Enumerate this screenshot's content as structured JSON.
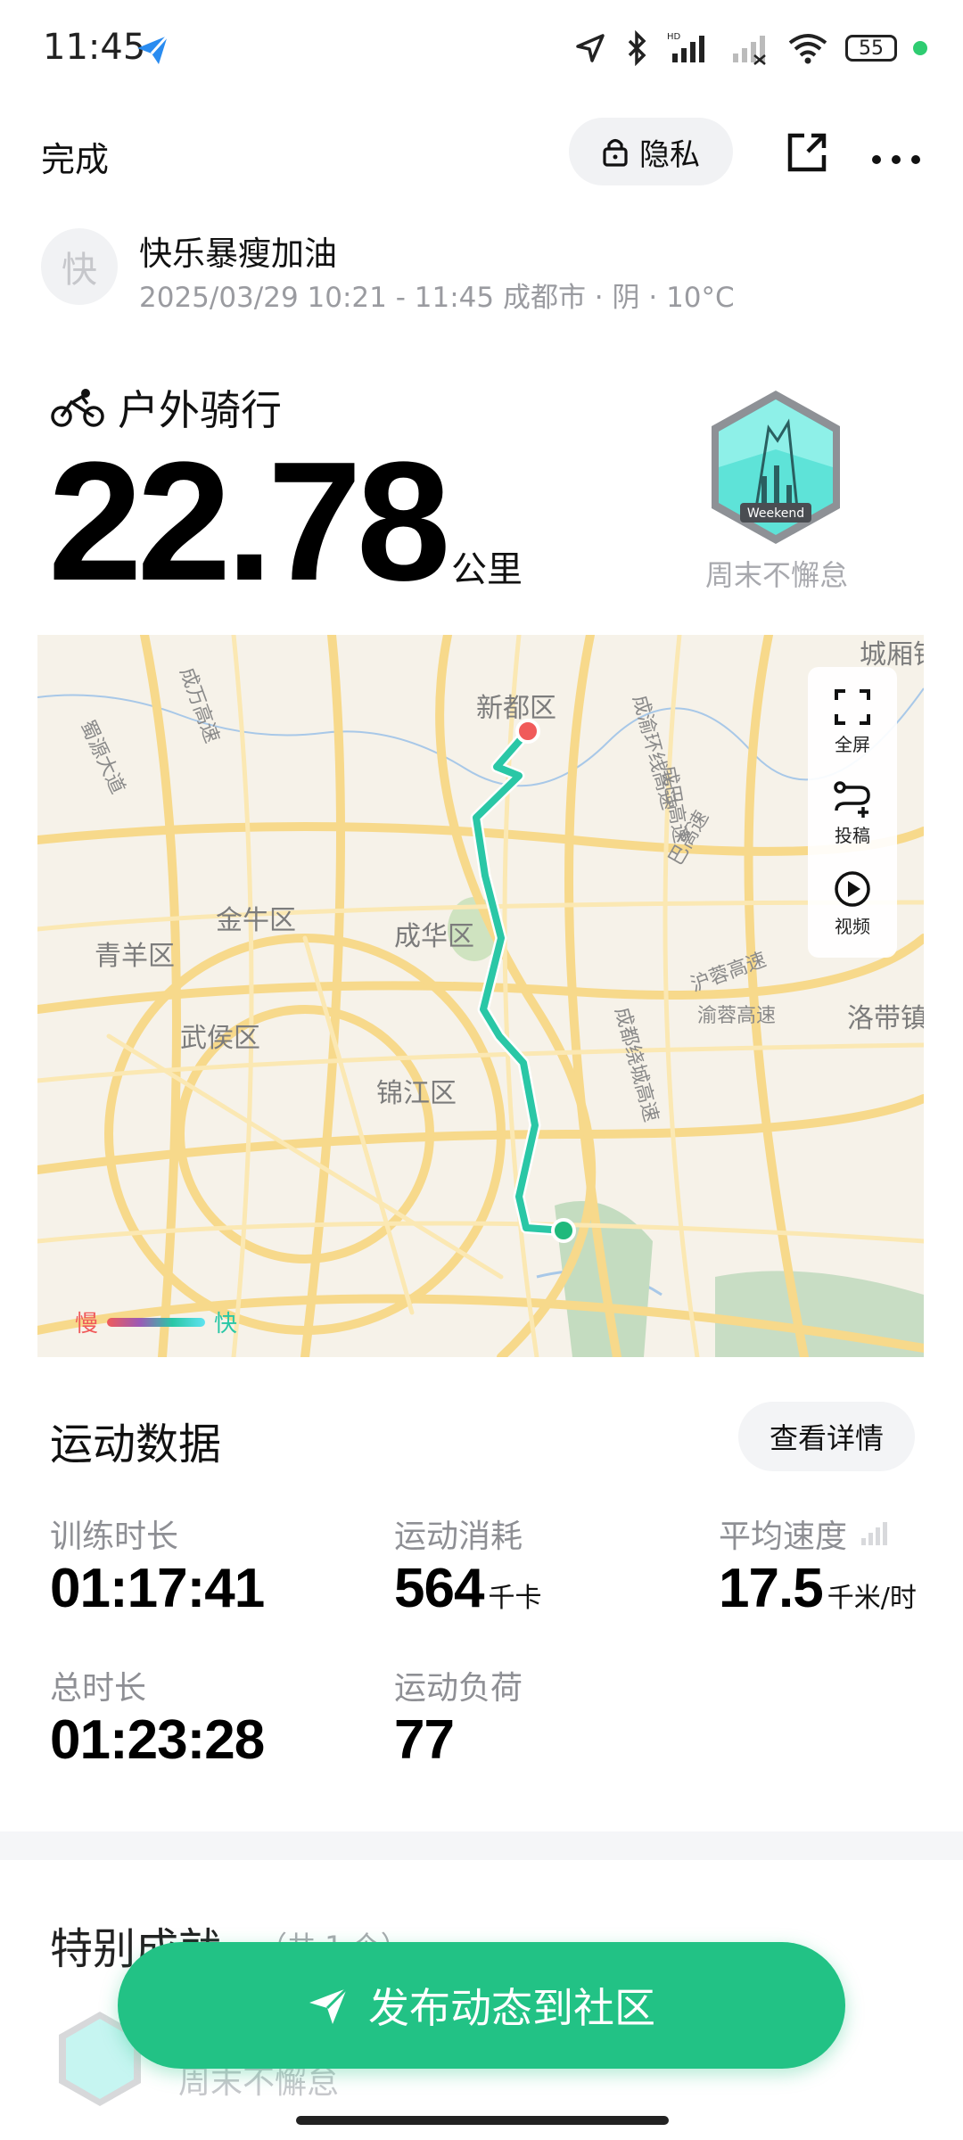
{
  "status_bar": {
    "time": "11:45",
    "battery": "55"
  },
  "header": {
    "done_label": "完成",
    "privacy_label": "隐私"
  },
  "user": {
    "avatar_initial": "快",
    "name": "快乐暴瘦加油",
    "meta": "2025/03/29 10:21 - 11:45 成都市 · 阴 · 10°C"
  },
  "activity": {
    "type": "户外骑行",
    "distance": "22.78",
    "distance_unit": "公里",
    "badge_text": "Weekend",
    "badge_caption": "周末不懈怠"
  },
  "map": {
    "controls": [
      {
        "label": "全屏",
        "icon": "fullscreen-icon"
      },
      {
        "label": "投稿",
        "icon": "route-add-icon"
      },
      {
        "label": "视频",
        "icon": "play-icon"
      }
    ],
    "legend_slow": "慢",
    "legend_fast": "快",
    "place_labels": [
      "新都区",
      "金牛区",
      "成华区",
      "青羊区",
      "武侯区",
      "锦江区",
      "洛带镇",
      "城厢镇",
      "成万高速",
      "蜀源大道",
      "成都绕城高速",
      "沪蓉高速",
      "渝蓉高速",
      "成渝环线高速",
      "成巴高速",
      "巴高速"
    ],
    "colors": {
      "start": "#1fb97c",
      "end": "#f05a5a",
      "route": "#2ac7a6"
    }
  },
  "stats": {
    "section_title": "运动数据",
    "detail_button": "查看详情",
    "items": [
      {
        "label": "训练时长",
        "value": "01:17:41",
        "unit": ""
      },
      {
        "label": "运动消耗",
        "value": "564",
        "unit": "千卡"
      },
      {
        "label": "平均速度",
        "value": "17.5",
        "unit": "千米/时"
      },
      {
        "label": "总时长",
        "value": "01:23:28",
        "unit": ""
      },
      {
        "label": "运动负荷",
        "value": "77",
        "unit": ""
      }
    ]
  },
  "special": {
    "title": "特别成就",
    "count": "（共 1 个）",
    "badge_name": "周末不懈怠"
  },
  "publish": {
    "label": "发布动态到社区",
    "color": "#22c285"
  }
}
